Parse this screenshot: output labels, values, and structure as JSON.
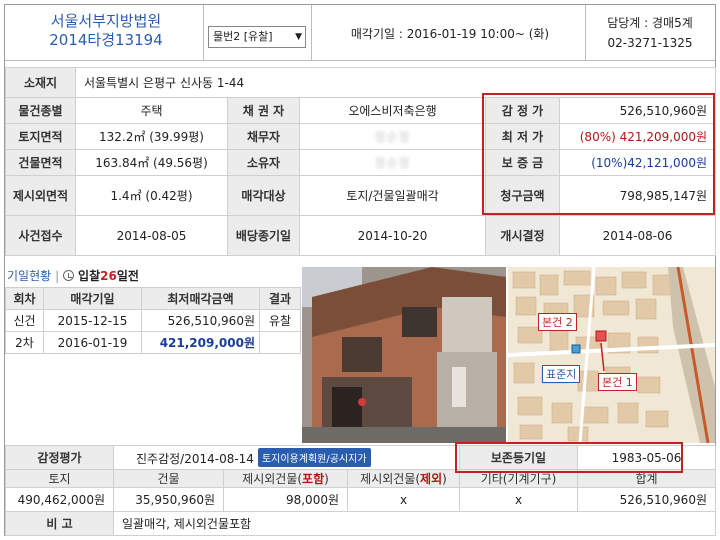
{
  "header": {
    "court": "서울서부지방법원",
    "case_no": "2014타경13194",
    "item_select": "물번2 [유찰]",
    "auction_date": "매각기일 : 2016-01-19   10:00~ (화)",
    "dept": "담당계 : 경매5계",
    "phone": "02-3271-1325"
  },
  "info": {
    "location_label": "소재지",
    "location": "서울특별시 은평구 신사동 1-44",
    "type_label": "물건종별",
    "type": "주택",
    "creditor_label": "채 권 자",
    "creditor": "오에스비저축은행",
    "appraisal_label": "감 정 가",
    "appraisal": "526,510,960원",
    "land_label": "토지면적",
    "land": "132.2㎡ (39.99평)",
    "debtor_label": "채무자",
    "debtor": "정순정",
    "min_price_label": "최 저 가",
    "min_price_pct": "(80%)",
    "min_price": "421,209,000원",
    "building_label": "건물면적",
    "building": "163.84㎡ (49.56평)",
    "owner_label": "소유자",
    "owner": "정순정",
    "deposit_label": "보 증 금",
    "deposit": "(10%)42,121,000원",
    "excluded_label": "제시외면적",
    "excluded": "1.4㎡ (0.42평)",
    "target_label": "매각대상",
    "target": "토지/건물일괄매각",
    "claim_label": "청구금액",
    "claim": "798,985,147원",
    "filed_label": "사건접수",
    "filed": "2014-08-05",
    "dividend_label": "배당종기일",
    "dividend": "2014-10-20",
    "start_label": "개시결정",
    "start": "2014-08-06"
  },
  "status": {
    "title": "기일현황",
    "day_prefix": "입찰",
    "day_num": "26",
    "day_suffix": "일전",
    "headers": [
      "회차",
      "매각기일",
      "최저매각금액",
      "결과"
    ],
    "rows": [
      {
        "round": "신건",
        "date": "2015-12-15",
        "price": "526,510,960원",
        "result": "유찰"
      },
      {
        "round": "2차",
        "date": "2016-01-19",
        "price": "421,209,000원",
        "result": ""
      }
    ]
  },
  "map": {
    "label_main2": "본건 2",
    "label_std": "표준지",
    "label_main1": "본건 1"
  },
  "bottom": {
    "eval_label": "감정평가",
    "eval_value": "진주감정/2014-08-14",
    "eval_link": "토지이용계획원/공시지가",
    "reg_label": "보존등기일",
    "reg_date": "1983-05-06",
    "headers": [
      "토지",
      "건물",
      "제시외건물(",
      "포함",
      ")",
      "제시외건물(",
      "제외",
      ")",
      "기타(기계기구)",
      "합계"
    ],
    "values": [
      "490,462,000원",
      "35,950,960원",
      "98,000원",
      "x",
      "x",
      "526,510,960원"
    ],
    "note_label": "비 고",
    "note": "일괄매각, 제시외건물포함"
  }
}
